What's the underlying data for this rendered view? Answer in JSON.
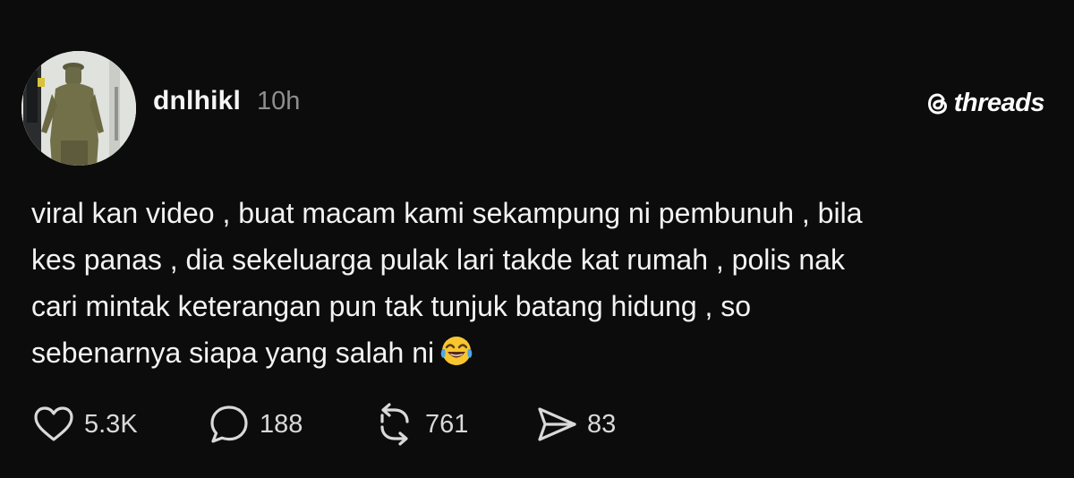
{
  "post": {
    "username": "dnlhikl",
    "timestamp": "10h",
    "brand": "threads",
    "text_lines": [
      "viral kan video , buat macam kami sekampung ni pembunuh , bila",
      "kes panas , dia sekeluarga pulak lari takde kat rumah , polis nak",
      "cari mintak keterangan pun tak tunjuk batang hidung , so",
      "sebenarnya siapa yang salah ni"
    ],
    "emoji": "face-with-tears-of-joy"
  },
  "actions": {
    "likes": "5.3K",
    "replies": "188",
    "reposts": "761",
    "shares": "83"
  },
  "icons": {
    "like": "heart-icon",
    "reply": "speech-bubble-icon",
    "repost": "repost-arrows-icon",
    "share": "send-icon",
    "brand": "threads-logo-icon"
  },
  "colors": {
    "background": "#0c0c0c",
    "text": "#f3f3f3",
    "muted": "#8e8e8e",
    "icon": "#d9d9d9"
  }
}
